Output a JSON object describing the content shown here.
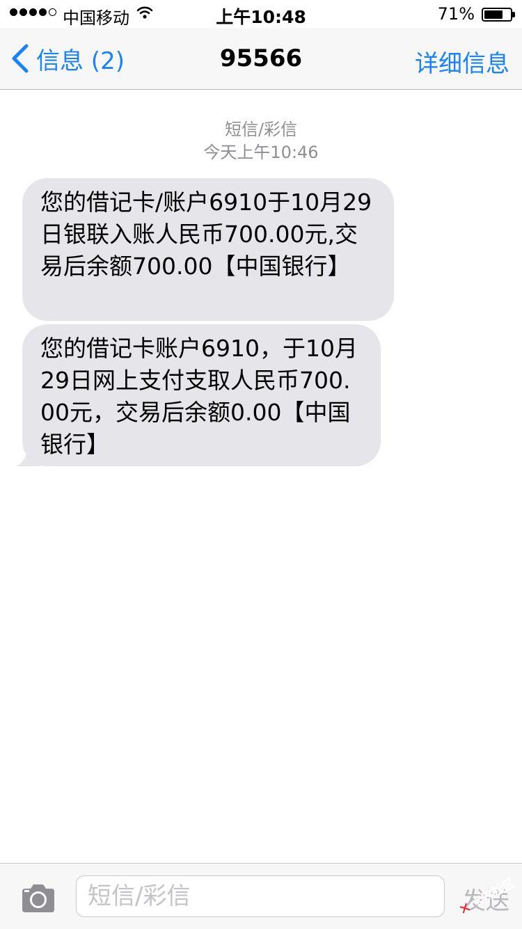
{
  "status_bar": {
    "signal_strength": 4,
    "signal_max": 5,
    "carrier": "中国移动",
    "wifi_icon": "wifi-icon",
    "time": "上午10:48",
    "battery_percent": "71%",
    "battery_level": 0.71
  },
  "nav": {
    "back_label": "信息 (2)",
    "back_icon": "chevron-left-icon",
    "title": "95566",
    "detail_label": "详细信息",
    "accent_color": "#1a82fb"
  },
  "conversation": {
    "message_type": "短信/彩信",
    "timestamp": "今天上午10:46",
    "messages": [
      {
        "text": "您的借记卡/账户6910于10月29日银联入账人民币700.00元,交易后余额700.00【中国银行】"
      },
      {
        "text": "您的借记卡账户6910，于10月29日网上支付支取人民币700.00元，交易后余额0.00【中国银行】"
      }
    ],
    "bubble_color": "#e5e5ea"
  },
  "input_bar": {
    "camera_icon": "camera-icon",
    "placeholder": "短信/彩信",
    "send_label": "发送"
  },
  "watermark": {
    "text": "卡农社区"
  }
}
